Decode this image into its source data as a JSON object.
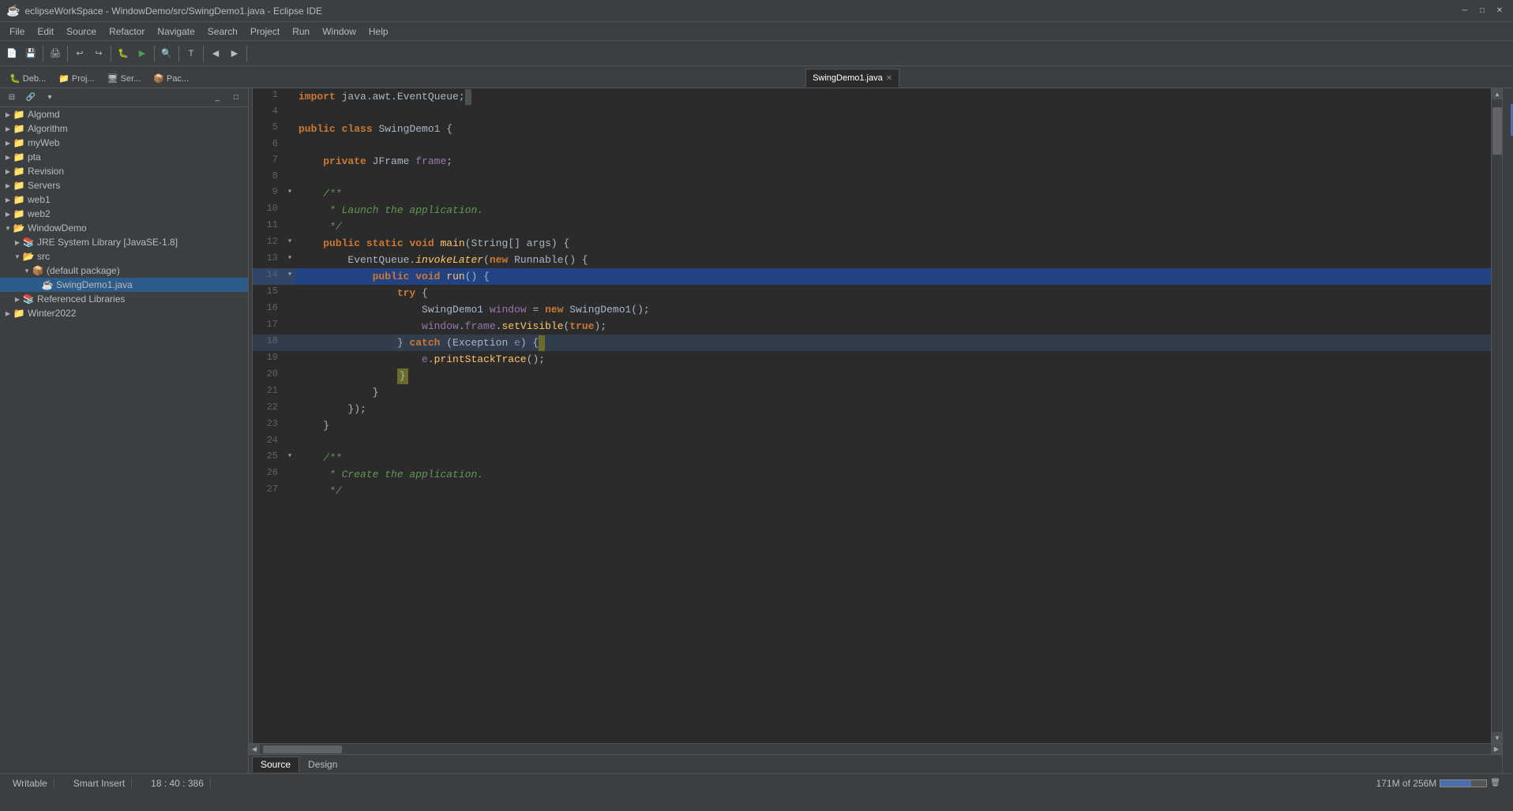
{
  "titleBar": {
    "icon": "☕",
    "title": "eclipseWorkSpace - WindowDemo/src/SwingDemo1.java - Eclipse IDE",
    "minimize": "─",
    "maximize": "□",
    "close": "✕"
  },
  "menuBar": {
    "items": [
      "File",
      "Edit",
      "Source",
      "Refactor",
      "Navigate",
      "Search",
      "Project",
      "Run",
      "Window",
      "Help"
    ]
  },
  "viewTabs": [
    {
      "label": "Deb...",
      "icon": "🐛"
    },
    {
      "label": "Proj...",
      "icon": "📁"
    },
    {
      "label": "Ser...",
      "icon": "🖥"
    },
    {
      "label": "Pac...",
      "icon": "📦"
    }
  ],
  "activeFile": {
    "name": "SwingDemo1.java",
    "closeBtn": "✕"
  },
  "sidebarItems": [
    {
      "id": "algomd",
      "label": "Algomd",
      "indent": 1,
      "hasArrow": true,
      "arrowOpen": false,
      "icon": "📁"
    },
    {
      "id": "algorithm",
      "label": "Algorithm",
      "indent": 1,
      "hasArrow": true,
      "arrowOpen": false,
      "icon": "📁"
    },
    {
      "id": "myweb",
      "label": "myWeb",
      "indent": 1,
      "hasArrow": true,
      "arrowOpen": false,
      "icon": "📁"
    },
    {
      "id": "pta",
      "label": "pta",
      "indent": 1,
      "hasArrow": true,
      "arrowOpen": false,
      "icon": "📁"
    },
    {
      "id": "revision",
      "label": "Revision",
      "indent": 1,
      "hasArrow": true,
      "arrowOpen": false,
      "icon": "📁"
    },
    {
      "id": "servers",
      "label": "Servers",
      "indent": 1,
      "hasArrow": true,
      "arrowOpen": false,
      "icon": "📁"
    },
    {
      "id": "web1",
      "label": "web1",
      "indent": 1,
      "hasArrow": true,
      "arrowOpen": false,
      "icon": "📁"
    },
    {
      "id": "web2",
      "label": "web2",
      "indent": 1,
      "hasArrow": true,
      "arrowOpen": false,
      "icon": "📁"
    },
    {
      "id": "windowdemo",
      "label": "WindowDemo",
      "indent": 1,
      "hasArrow": true,
      "arrowOpen": true,
      "icon": "📁"
    },
    {
      "id": "jre-lib",
      "label": "JRE System Library [JavaSE-1.8]",
      "indent": 2,
      "hasArrow": true,
      "arrowOpen": false,
      "icon": "📚"
    },
    {
      "id": "src",
      "label": "src",
      "indent": 2,
      "hasArrow": true,
      "arrowOpen": true,
      "icon": "📂"
    },
    {
      "id": "default-pkg",
      "label": "(default package)",
      "indent": 3,
      "hasArrow": true,
      "arrowOpen": true,
      "icon": "📦"
    },
    {
      "id": "swingdemo1",
      "label": "SwingDemo1.java",
      "indent": 4,
      "hasArrow": false,
      "arrowOpen": false,
      "icon": "☕",
      "selected": true
    },
    {
      "id": "ref-libs",
      "label": "Referenced Libraries",
      "indent": 2,
      "hasArrow": true,
      "arrowOpen": false,
      "icon": "📚"
    },
    {
      "id": "winter2022",
      "label": "Winter2022",
      "indent": 1,
      "hasArrow": true,
      "arrowOpen": false,
      "icon": "📁"
    }
  ],
  "codeLines": [
    {
      "num": 1,
      "marker": "",
      "content": "import_java.awt.EventQueue;",
      "type": "import"
    },
    {
      "num": 4,
      "marker": "",
      "content": "",
      "type": "blank"
    },
    {
      "num": 5,
      "marker": "",
      "content": "public_class_SwingDemo1_{",
      "type": "class"
    },
    {
      "num": 6,
      "marker": "",
      "content": "",
      "type": "blank"
    },
    {
      "num": 7,
      "marker": "",
      "content": "    private_JFrame_frame;",
      "type": "field"
    },
    {
      "num": 8,
      "marker": "",
      "content": "",
      "type": "blank"
    },
    {
      "num": 9,
      "marker": "fold",
      "content": "    /**",
      "type": "javadoc"
    },
    {
      "num": 10,
      "marker": "",
      "content": "     * Launch the application.",
      "type": "javadoc"
    },
    {
      "num": 11,
      "marker": "",
      "content": "     */",
      "type": "javadoc"
    },
    {
      "num": 12,
      "marker": "fold",
      "content": "    public_static_void_main(String[]_args)_{",
      "type": "method"
    },
    {
      "num": 13,
      "marker": "fold",
      "content": "        EventQueue.invokeLater(new_Runnable()_{",
      "type": "code"
    },
    {
      "num": 14,
      "marker": "fold",
      "content": "            public_void_run()_{",
      "type": "method",
      "highlighted": true
    },
    {
      "num": 15,
      "marker": "",
      "content": "                try_{",
      "type": "code"
    },
    {
      "num": 16,
      "marker": "",
      "content": "                    SwingDemo1_window_=_new_SwingDemo1();",
      "type": "code"
    },
    {
      "num": 17,
      "marker": "",
      "content": "                    window.frame.setVisible(true);",
      "type": "code"
    },
    {
      "num": 18,
      "marker": "",
      "content": "                }_catch_(Exception_e)_{",
      "type": "code"
    },
    {
      "num": 19,
      "marker": "",
      "content": "                    e.printStackTrace();",
      "type": "code"
    },
    {
      "num": 20,
      "marker": "",
      "content": "                }",
      "type": "code"
    },
    {
      "num": 21,
      "marker": "",
      "content": "            }",
      "type": "code"
    },
    {
      "num": 22,
      "marker": "",
      "content": "        });",
      "type": "code"
    },
    {
      "num": 23,
      "marker": "",
      "content": "    }",
      "type": "code"
    },
    {
      "num": 24,
      "marker": "",
      "content": "",
      "type": "blank"
    },
    {
      "num": 25,
      "marker": "fold",
      "content": "    /**",
      "type": "javadoc"
    },
    {
      "num": 26,
      "marker": "",
      "content": "     * Create the application.",
      "type": "javadoc"
    },
    {
      "num": 27,
      "marker": "",
      "content": "     */",
      "type": "javadoc"
    }
  ],
  "bottomTabs": [
    "Source",
    "Design"
  ],
  "activeBottomTab": "Source",
  "statusBar": {
    "writable": "Writable",
    "insertMode": "Smart Insert",
    "position": "18 : 40 : 386",
    "memory": "171M of 256M"
  }
}
